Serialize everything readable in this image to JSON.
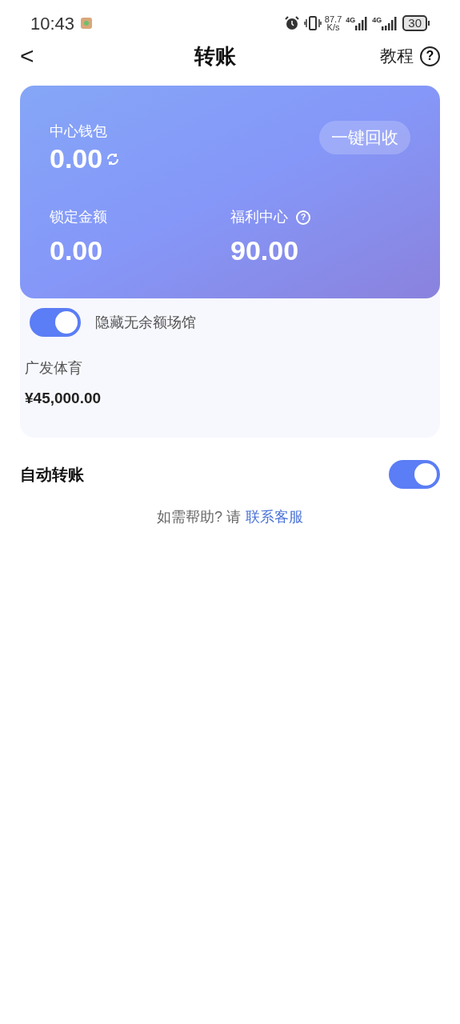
{
  "status_bar": {
    "time": "10:43",
    "net_speed": "87.7",
    "net_unit": "K/s",
    "sim1": "4G",
    "sim2": "4G",
    "battery": "30"
  },
  "header": {
    "back": "<",
    "title": "转账",
    "tutorial": "教程",
    "help": "?"
  },
  "wallet_card": {
    "center_wallet": {
      "label": "中心钱包",
      "amount": "0.00"
    },
    "recycle_button": "一键回收",
    "locked": {
      "label": "锁定金额",
      "amount": "0.00"
    },
    "welfare": {
      "label": "福利中心",
      "help": "?",
      "amount": "90.00"
    }
  },
  "hide_empty": {
    "label": "隐藏无余额场馆",
    "on": true
  },
  "venues": [
    {
      "name": "广发体育",
      "amount": "¥45,000.00"
    }
  ],
  "auto_transfer": {
    "label": "自动转账",
    "on": true
  },
  "help": {
    "text": "如需帮助? 请",
    "link": "联系客服"
  }
}
